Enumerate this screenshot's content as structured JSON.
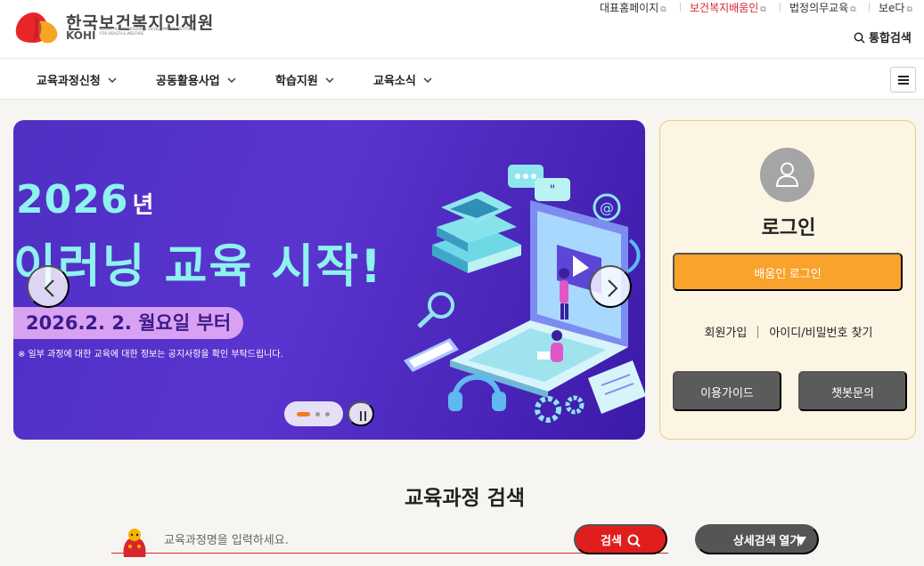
{
  "header": {
    "logo": {
      "korean": "한국보건복지인재원",
      "english": "KOHI",
      "sub": "KOREA HUMAN RESOURCE DEVELOPMENT INSTITUTE FOR HEALTH & WELFARE"
    },
    "util_links": [
      {
        "label": "대표홈페이지",
        "icon": "external-link-icon"
      },
      {
        "label": "보건복지배움인",
        "icon": "external-link-icon"
      },
      {
        "label": "법정의무교육",
        "icon": "external-link-icon"
      },
      {
        "label": "보e다",
        "icon": "external-link-icon"
      }
    ],
    "search_all": "통합검색"
  },
  "nav": {
    "items": [
      "교육과정신청",
      "공동활용사업",
      "학습지원",
      "교육소식"
    ]
  },
  "banner": {
    "year": "2026",
    "year_suffix": "년",
    "title": "이러닝 교육 시작!",
    "date": "2026.2. 2. 월요일 부터",
    "note": "※ 일부 과정에 대한 교육에 대한 정보는 공지사항을 확인 부탁드립니다.",
    "slides_total": 3,
    "active_slide": 1
  },
  "login": {
    "title": "로그인",
    "login_button": "배움인 로그인",
    "signup": "회원가입",
    "find_account": "아이디/비밀번호 찾기",
    "guide_button": "이용가이드",
    "chatbot_button": "챗봇문의"
  },
  "search": {
    "title": "교육과정 검색",
    "placeholder": "교육과정명을 입력하세요.",
    "search_button": "검색",
    "advanced_button": "상세검색 열기"
  },
  "colors": {
    "accent_red": "#d8262d",
    "login_orange": "#f9a22c",
    "banner_purple": "#5a34cf",
    "banner_cyan": "#8ef2ef"
  }
}
